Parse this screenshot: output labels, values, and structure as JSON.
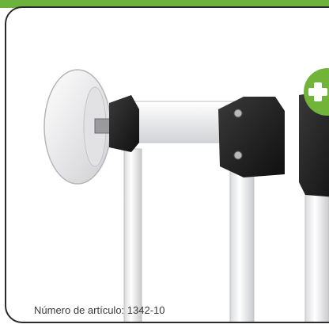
{
  "caption": {
    "text": "Número de artículo: 1342-10"
  },
  "badge": {
    "icon": "plus-icon",
    "color": "#72b33a"
  },
  "brand": {
    "accent": "#6cb33e"
  }
}
